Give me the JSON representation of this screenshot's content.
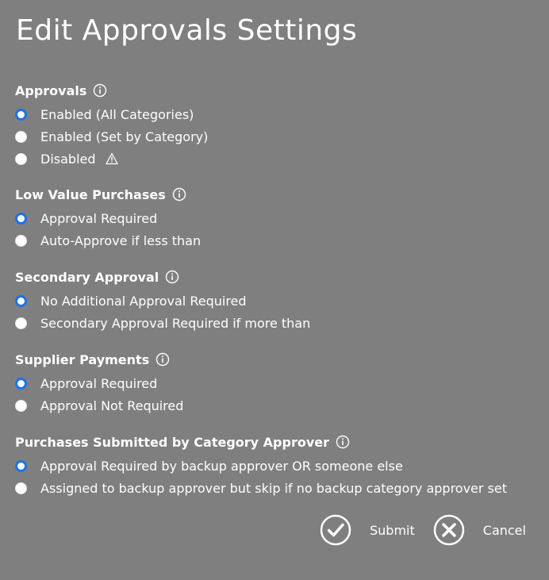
{
  "dialog": {
    "title": "Edit Approvals Settings"
  },
  "sections": [
    {
      "label": "Approvals",
      "info_icon": "info-icon",
      "options": [
        {
          "label": "Enabled (All Categories)",
          "selected": true
        },
        {
          "label": "Enabled (Set by Category)",
          "selected": false
        },
        {
          "label": "Disabled",
          "selected": false,
          "icon": "warning-icon"
        }
      ]
    },
    {
      "label": "Low Value Purchases",
      "info_icon": "info-icon",
      "options": [
        {
          "label": "Approval Required",
          "selected": true
        },
        {
          "label": "Auto-Approve if less than",
          "selected": false
        }
      ]
    },
    {
      "label": "Secondary Approval",
      "info_icon": "info-icon",
      "options": [
        {
          "label": "No Additional Approval Required",
          "selected": true
        },
        {
          "label": "Secondary Approval Required if more than",
          "selected": false
        }
      ]
    },
    {
      "label": "Supplier Payments",
      "info_icon": "info-icon",
      "options": [
        {
          "label": "Approval Required",
          "selected": true
        },
        {
          "label": "Approval Not Required",
          "selected": false
        }
      ]
    },
    {
      "label": "Purchases Submitted by Category Approver",
      "info_icon": "info-icon",
      "options": [
        {
          "label": "Approval Required by backup approver OR someone else",
          "selected": true
        },
        {
          "label": "Assigned to backup approver but skip if no backup category approver set",
          "selected": false
        }
      ]
    }
  ],
  "actions": {
    "submit_label": "Submit",
    "submit_icon": "check-circle-icon",
    "cancel_label": "Cancel",
    "cancel_icon": "x-circle-icon"
  },
  "colors": {
    "background": "#7f7f7f",
    "text": "#ffffff",
    "radio_selected": "#1a73e8"
  }
}
